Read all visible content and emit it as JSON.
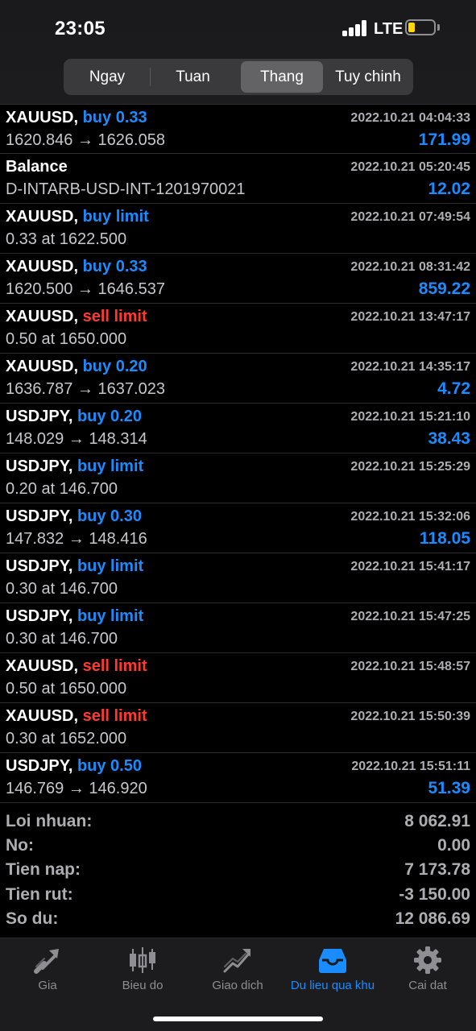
{
  "status_bar": {
    "time": "23:05",
    "network": "LTE",
    "battery_level": 0.25,
    "battery_color": "#ffd60a"
  },
  "segments": {
    "items": [
      "Ngay",
      "Tuan",
      "Thang",
      "Tuy chinh"
    ],
    "selected": "Thang"
  },
  "orders": [
    {
      "symbol": "XAUUSD,",
      "type": "buy 0.33",
      "side": "buy",
      "time": "2022.10.21 04:04:33",
      "detail": "1620.846 → 1626.058",
      "profit": "171.99"
    },
    {
      "symbol": "Balance",
      "type": "",
      "side": "",
      "time": "2022.10.21 05:20:45",
      "detail": "D-INTARB-USD-INT-1201970021",
      "profit": "12.02"
    },
    {
      "symbol": "XAUUSD,",
      "type": "buy limit",
      "side": "buy",
      "time": "2022.10.21 07:49:54",
      "detail": "0.33 at 1622.500",
      "profit": ""
    },
    {
      "symbol": "XAUUSD,",
      "type": "buy 0.33",
      "side": "buy",
      "time": "2022.10.21 08:31:42",
      "detail": "1620.500 → 1646.537",
      "profit": "859.22"
    },
    {
      "symbol": "XAUUSD,",
      "type": "sell limit",
      "side": "sell",
      "time": "2022.10.21 13:47:17",
      "detail": "0.50 at 1650.000",
      "profit": ""
    },
    {
      "symbol": "XAUUSD,",
      "type": "buy 0.20",
      "side": "buy",
      "time": "2022.10.21 14:35:17",
      "detail": "1636.787 → 1637.023",
      "profit": "4.72"
    },
    {
      "symbol": "USDJPY,",
      "type": "buy 0.20",
      "side": "buy",
      "time": "2022.10.21 15:21:10",
      "detail": "148.029 → 148.314",
      "profit": "38.43"
    },
    {
      "symbol": "USDJPY,",
      "type": "buy limit",
      "side": "buy",
      "time": "2022.10.21 15:25:29",
      "detail": "0.20 at 146.700",
      "profit": ""
    },
    {
      "symbol": "USDJPY,",
      "type": "buy 0.30",
      "side": "buy",
      "time": "2022.10.21 15:32:06",
      "detail": "147.832 → 148.416",
      "profit": "118.05"
    },
    {
      "symbol": "USDJPY,",
      "type": "buy limit",
      "side": "buy",
      "time": "2022.10.21 15:41:17",
      "detail": "0.30 at 146.700",
      "profit": ""
    },
    {
      "symbol": "USDJPY,",
      "type": "buy limit",
      "side": "buy",
      "time": "2022.10.21 15:47:25",
      "detail": "0.30 at 146.700",
      "profit": ""
    },
    {
      "symbol": "XAUUSD,",
      "type": "sell limit",
      "side": "sell",
      "time": "2022.10.21 15:48:57",
      "detail": "0.50 at 1650.000",
      "profit": ""
    },
    {
      "symbol": "XAUUSD,",
      "type": "sell limit",
      "side": "sell",
      "time": "2022.10.21 15:50:39",
      "detail": "0.30 at 1652.000",
      "profit": ""
    },
    {
      "symbol": "USDJPY,",
      "type": "buy 0.50",
      "side": "buy",
      "time": "2022.10.21 15:51:11",
      "detail": "146.769 → 146.920",
      "profit": "51.39"
    }
  ],
  "summary": [
    {
      "label": "Loi nhuan:",
      "value": "8 062.91"
    },
    {
      "label": "No:",
      "value": "0.00"
    },
    {
      "label": "Tien nap:",
      "value": "7 173.78"
    },
    {
      "label": "Tien rut:",
      "value": "-3 150.00"
    },
    {
      "label": "So du:",
      "value": "12 086.69"
    }
  ],
  "tabs": [
    {
      "label": "Gia",
      "icon": "price-arrows-icon"
    },
    {
      "label": "Bieu do",
      "icon": "candlestick-chart-icon"
    },
    {
      "label": "Giao dich",
      "icon": "trade-trend-icon"
    },
    {
      "label": "Du lieu qua khu",
      "icon": "history-inbox-icon"
    },
    {
      "label": "Cai dat",
      "icon": "gear-icon"
    }
  ],
  "active_tab": "Du lieu qua khu",
  "colors": {
    "accent": "#1a8cff",
    "sell": "#ff3b30",
    "muted": "#8e8e93"
  }
}
